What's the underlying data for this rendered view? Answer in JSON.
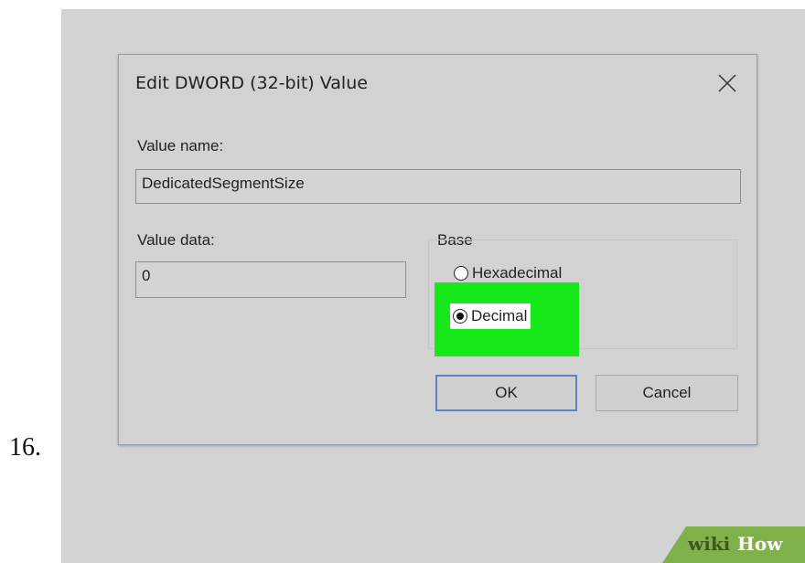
{
  "step_number": "16.",
  "dialog": {
    "title": "Edit DWORD (32-bit) Value",
    "value_name_label": "Value name:",
    "value_name": "DedicatedSegmentSize",
    "value_data_label": "Value data:",
    "value_data": "0",
    "base_label": "Base",
    "radio_options": [
      {
        "label": "Hexadecimal",
        "selected": false
      },
      {
        "label": "Decimal",
        "selected": true
      }
    ],
    "ok_label": "OK",
    "cancel_label": "Cancel"
  },
  "highlight_color": "#17e81a",
  "watermark": {
    "wiki": "wiki",
    "how": "How"
  }
}
